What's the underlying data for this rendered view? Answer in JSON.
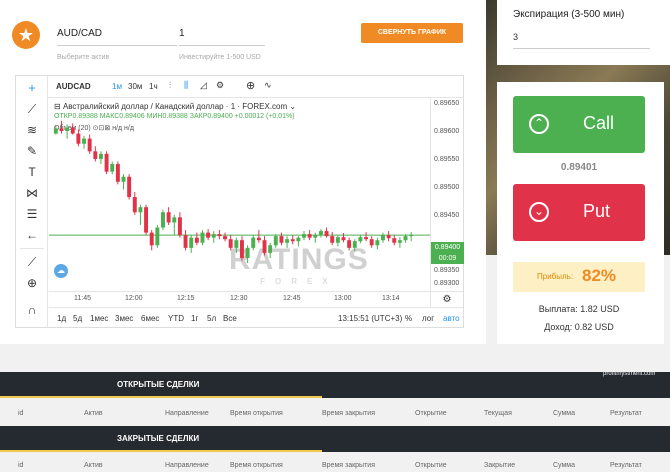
{
  "trade_form": {
    "asset_value": "AUD/CAD",
    "asset_hint": "Выберите актив",
    "amount_value": "1",
    "amount_hint": "Инвестируйте 1-500 USD",
    "collapse_button": "СВЕРНУТЬ ГРАФИК"
  },
  "chart_toolbar": {
    "symbol": "AUDCAD",
    "intervals": [
      "1м",
      "30м",
      "1ч"
    ],
    "active_interval": "1м"
  },
  "chart_legend": {
    "title": "Австралийский доллар / Канадский доллар · 1 · FOREX.com",
    "open_label": "ОТКР",
    "open": "0.89388",
    "high_label": "МАКС",
    "high": "0.89406",
    "low_label": "МИН",
    "low": "0.89388",
    "close_label": "ЗАКР",
    "close": "0.89400",
    "change": "+0.00012 (+0.01%)",
    "volume_label": "Объем (20)",
    "volume_values": "н/д  н/д"
  },
  "price_axis": [
    "0.89650",
    "0.89600",
    "0.89550",
    "0.89500",
    "0.89450",
    "0.89350",
    "0.89300"
  ],
  "current_price_tag": "0.89400",
  "countdown_tag": "00:09",
  "time_axis": [
    "11:45",
    "12:00",
    "12:15",
    "12:30",
    "12:45",
    "13:00",
    "13:14"
  ],
  "watermark": "RATINGS",
  "watermark_sub": "FOREX",
  "bottom_bar": {
    "ranges": [
      "1д",
      "5д",
      "1мес",
      "3мес",
      "6мес",
      "YTD",
      "1г",
      "5л",
      "Все"
    ],
    "clock": "13:15:51 (UTC+3)",
    "percent": "%",
    "log": "лог",
    "auto": "авто"
  },
  "expiration": {
    "label": "Экспирация (3-500 мин)",
    "value": "3"
  },
  "call_label": "Call",
  "put_label": "Put",
  "current_price": "0.89401",
  "profit": {
    "label": "Прибыль:",
    "value": "82%"
  },
  "payout": "Выплата: 1.82 USD",
  "income": "Доход: 0.82 USD",
  "brand": "profitmystment.com",
  "open_deals": {
    "title": "ОТКРЫТЫЕ СДЕЛКИ",
    "columns": [
      "id",
      "Актив",
      "Направление",
      "Время открытия",
      "Время закрытия",
      "Открытие",
      "Текущая",
      "Сумма",
      "Результат"
    ]
  },
  "closed_deals": {
    "title": "ЗАКРЫТЫЕ СДЕЛКИ",
    "columns": [
      "id",
      "Актив",
      "Направление",
      "Время открытия",
      "Время закрытия",
      "Открытие",
      "Закрытие",
      "Сумма",
      "Результат"
    ]
  },
  "colors": {
    "accent": "#f08a24",
    "call": "#4caf50",
    "put": "#e0334a",
    "up_candle": "#4caf50",
    "down_candle": "#e0334a",
    "dark_bar": "#252a30"
  },
  "chart_data": {
    "type": "candlestick",
    "y_range": [
      0.8929,
      0.8967
    ],
    "candles": [
      [
        0.896,
        0.89615,
        0.89598,
        0.8961
      ],
      [
        0.8961,
        0.89625,
        0.896,
        0.89605
      ],
      [
        0.89605,
        0.89618,
        0.8959,
        0.89612
      ],
      [
        0.89612,
        0.8962,
        0.89598,
        0.896
      ],
      [
        0.896,
        0.89608,
        0.89575,
        0.8958
      ],
      [
        0.8958,
        0.89595,
        0.8957,
        0.8959
      ],
      [
        0.8959,
        0.89598,
        0.8956,
        0.89565
      ],
      [
        0.89565,
        0.89575,
        0.89545,
        0.8955
      ],
      [
        0.8955,
        0.89565,
        0.8954,
        0.8956
      ],
      [
        0.8956,
        0.89565,
        0.8952,
        0.89525
      ],
      [
        0.89525,
        0.89545,
        0.8952,
        0.8954
      ],
      [
        0.8954,
        0.89545,
        0.895,
        0.89505
      ],
      [
        0.89505,
        0.8952,
        0.8949,
        0.89515
      ],
      [
        0.89515,
        0.8952,
        0.8947,
        0.89475
      ],
      [
        0.89475,
        0.89485,
        0.8944,
        0.89445
      ],
      [
        0.89445,
        0.8946,
        0.8942,
        0.89455
      ],
      [
        0.89455,
        0.8946,
        0.894,
        0.89405
      ],
      [
        0.89405,
        0.8941,
        0.8937,
        0.8938
      ],
      [
        0.8938,
        0.8942,
        0.89375,
        0.89415
      ],
      [
        0.89415,
        0.8945,
        0.8941,
        0.89445
      ],
      [
        0.89445,
        0.89455,
        0.8942,
        0.89425
      ],
      [
        0.89425,
        0.8944,
        0.894,
        0.89435
      ],
      [
        0.89435,
        0.89445,
        0.89395,
        0.894
      ],
      [
        0.894,
        0.8941,
        0.8937,
        0.89375
      ],
      [
        0.89375,
        0.894,
        0.89365,
        0.89395
      ],
      [
        0.89395,
        0.89405,
        0.8938,
        0.89385
      ],
      [
        0.89385,
        0.8941,
        0.8938,
        0.89405
      ],
      [
        0.89405,
        0.89412,
        0.8939,
        0.89395
      ],
      [
        0.89395,
        0.89408,
        0.89385,
        0.89402
      ],
      [
        0.89402,
        0.8941,
        0.89392,
        0.89398
      ],
      [
        0.89398,
        0.89405,
        0.89388,
        0.89392
      ],
      [
        0.89392,
        0.894,
        0.8937,
        0.89375
      ],
      [
        0.89375,
        0.89395,
        0.89365,
        0.8939
      ],
      [
        0.8939,
        0.89398,
        0.8935,
        0.89355
      ],
      [
        0.89355,
        0.8938,
        0.89345,
        0.89375
      ],
      [
        0.89375,
        0.894,
        0.8937,
        0.89395
      ],
      [
        0.89395,
        0.8941,
        0.89385,
        0.8939
      ],
      [
        0.8939,
        0.89398,
        0.8936,
        0.89365
      ],
      [
        0.89365,
        0.89385,
        0.89355,
        0.8938
      ],
      [
        0.8938,
        0.89402,
        0.89375,
        0.89398
      ],
      [
        0.89398,
        0.89405,
        0.8938,
        0.89385
      ],
      [
        0.89385,
        0.89398,
        0.89375,
        0.89392
      ],
      [
        0.89392,
        0.894,
        0.89382,
        0.89388
      ],
      [
        0.89388,
        0.89398,
        0.89378,
        0.89395
      ],
      [
        0.89395,
        0.89408,
        0.8939,
        0.89402
      ],
      [
        0.89402,
        0.8941,
        0.8939,
        0.89395
      ],
      [
        0.89395,
        0.89405,
        0.89385,
        0.894
      ],
      [
        0.894,
        0.89412,
        0.89395,
        0.89408
      ],
      [
        0.89408,
        0.89415,
        0.89395,
        0.89398
      ],
      [
        0.89398,
        0.89406,
        0.8938,
        0.89385
      ],
      [
        0.89385,
        0.894,
        0.89378,
        0.89396
      ],
      [
        0.89396,
        0.89404,
        0.89386,
        0.8939
      ],
      [
        0.8939,
        0.89395,
        0.8937,
        0.89375
      ],
      [
        0.89375,
        0.89392,
        0.89368,
        0.89388
      ],
      [
        0.89388,
        0.894,
        0.89384,
        0.89396
      ],
      [
        0.89396,
        0.89406,
        0.89388,
        0.89392
      ],
      [
        0.89392,
        0.89398,
        0.89375,
        0.8938
      ],
      [
        0.8938,
        0.89395,
        0.89372,
        0.8939
      ],
      [
        0.8939,
        0.89405,
        0.89385,
        0.894
      ],
      [
        0.894,
        0.89408,
        0.89388,
        0.89394
      ],
      [
        0.89394,
        0.894,
        0.8938,
        0.89385
      ],
      [
        0.89385,
        0.89396,
        0.89375,
        0.8939
      ],
      [
        0.8939,
        0.89402,
        0.89385,
        0.89398
      ],
      [
        0.89398,
        0.89406,
        0.89388,
        0.894
      ]
    ]
  }
}
